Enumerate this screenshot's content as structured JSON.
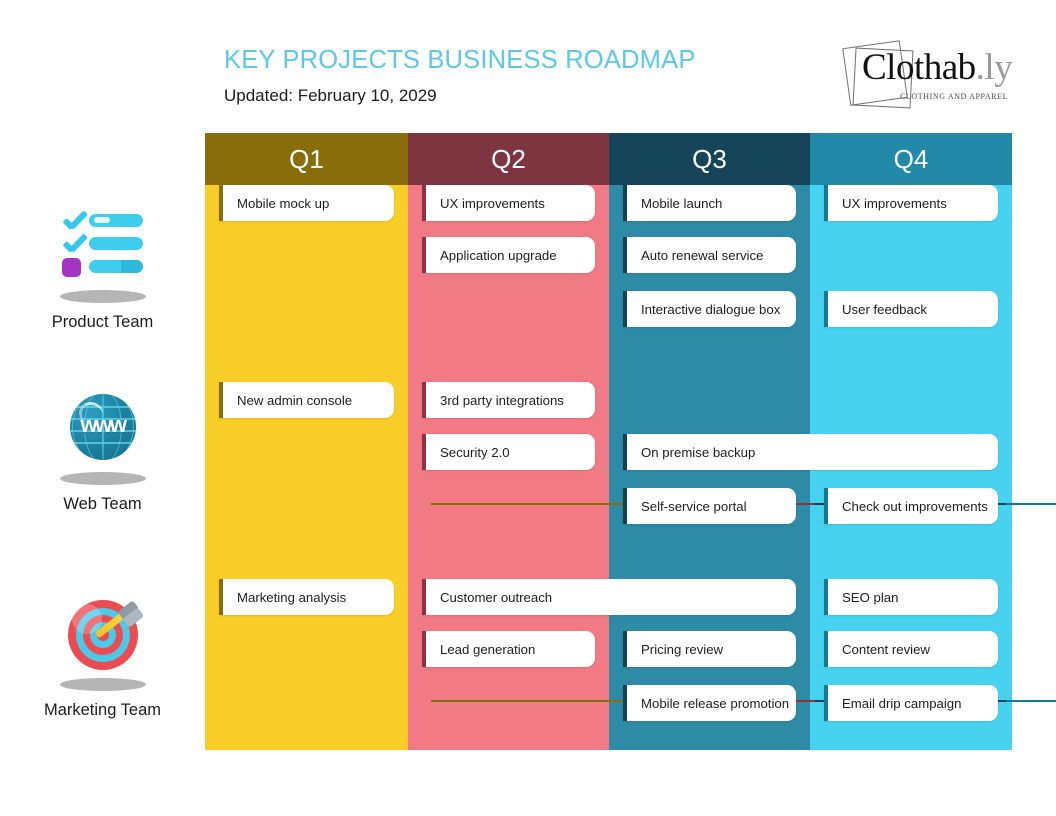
{
  "header": {
    "title": "KEY PROJECTS BUSINESS ROADMAP",
    "subtitle": "Updated: February 10, 2029",
    "title_color": "#5BC8E8"
  },
  "logo": {
    "brand": "Clothab",
    "suffix": ".ly",
    "tagline": "CLOTHING AND APPAREL"
  },
  "columns": [
    {
      "label": "Q1",
      "head_color": "#8a6d0b",
      "body_color": "#F9CE29",
      "accent_color": "#8a6d0b"
    },
    {
      "label": "Q2",
      "head_color": "#7E3540",
      "body_color": "#F27A84",
      "accent_color": "#8c3340"
    },
    {
      "label": "Q3",
      "head_color": "#16455A",
      "body_color": "#2E8BA6",
      "accent_color": "#14424f"
    },
    {
      "label": "Q4",
      "head_color": "#2389A8",
      "body_color": "#47D3EF",
      "accent_color": "#157a91"
    }
  ],
  "teams": [
    {
      "name": "Product Team",
      "icon": "checklist-icon"
    },
    {
      "name": "Web Team",
      "icon": "globe-www-icon"
    },
    {
      "name": "Marketing Team",
      "icon": "target-dart-icon"
    }
  ],
  "cards": [
    {
      "text": "Mobile mock up",
      "row": 0,
      "col": 0,
      "slot": 0,
      "span": 1
    },
    {
      "text": "UX improvements",
      "row": 0,
      "col": 1,
      "slot": 0,
      "span": 1
    },
    {
      "text": "Application upgrade",
      "row": 0,
      "col": 1,
      "slot": 1,
      "span": 1
    },
    {
      "text": "Mobile launch",
      "row": 0,
      "col": 2,
      "slot": 0,
      "span": 1
    },
    {
      "text": "Auto renewal service",
      "row": 0,
      "col": 2,
      "slot": 1,
      "span": 1
    },
    {
      "text": "Interactive dialogue box",
      "row": 0,
      "col": 2,
      "slot": 2,
      "span": 1
    },
    {
      "text": "UX improvements",
      "row": 0,
      "col": 3,
      "slot": 0,
      "span": 1
    },
    {
      "text": "User feedback",
      "row": 0,
      "col": 3,
      "slot": 2,
      "span": 1
    },
    {
      "text": "New admin console",
      "row": 1,
      "col": 0,
      "slot": 0,
      "span": 1
    },
    {
      "text": "3rd party integrations",
      "row": 1,
      "col": 1,
      "slot": 0,
      "span": 1
    },
    {
      "text": "Security 2.0",
      "row": 1,
      "col": 1,
      "slot": 1,
      "span": 1
    },
    {
      "text": "On premise backup",
      "row": 1,
      "col": 2,
      "slot": 1,
      "span": 2
    },
    {
      "text": "Self-service portal",
      "row": 1,
      "col": 2,
      "slot": 2,
      "span": 1
    },
    {
      "text": "Check out improvements",
      "row": 1,
      "col": 3,
      "slot": 2,
      "span": 1
    },
    {
      "text": "Marketing analysis",
      "row": 2,
      "col": 0,
      "slot": 0,
      "span": 1
    },
    {
      "text": "Customer outreach",
      "row": 2,
      "col": 1,
      "slot": 0,
      "span": 2
    },
    {
      "text": "Lead generation",
      "row": 2,
      "col": 1,
      "slot": 1,
      "span": 1
    },
    {
      "text": "SEO plan",
      "row": 2,
      "col": 3,
      "slot": 0,
      "span": 1
    },
    {
      "text": "Pricing review",
      "row": 2,
      "col": 2,
      "slot": 1,
      "span": 1
    },
    {
      "text": "Content review",
      "row": 2,
      "col": 3,
      "slot": 1,
      "span": 1
    },
    {
      "text": "Mobile release promotion",
      "row": 2,
      "col": 2,
      "slot": 2,
      "span": 1
    },
    {
      "text": "Email drip campaign",
      "row": 2,
      "col": 3,
      "slot": 2,
      "span": 1
    }
  ],
  "icons": {
    "www_text": "www"
  }
}
